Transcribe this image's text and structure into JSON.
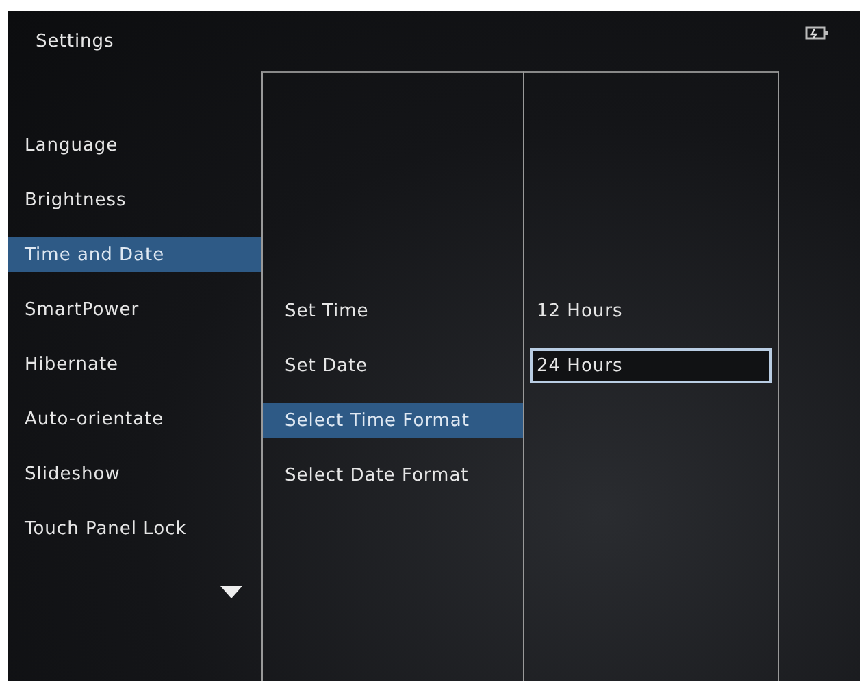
{
  "window": {
    "title": "Settings"
  },
  "menu": [
    {
      "label": "Language",
      "selected": false
    },
    {
      "label": "Brightness",
      "selected": false
    },
    {
      "label": "Time and Date",
      "selected": true
    },
    {
      "label": "SmartPower",
      "selected": false
    },
    {
      "label": "Hibernate",
      "selected": false
    },
    {
      "label": "Auto-orientate",
      "selected": false
    },
    {
      "label": "Slideshow",
      "selected": false
    },
    {
      "label": "Touch Panel Lock",
      "selected": false
    }
  ],
  "submenu": [
    {
      "label": "Set Time",
      "selected": false
    },
    {
      "label": "Set Date",
      "selected": false
    },
    {
      "label": "Select Time Format",
      "selected": true
    },
    {
      "label": "Select Date Format",
      "selected": false
    }
  ],
  "options": [
    {
      "label": "12 Hours",
      "selected": false
    },
    {
      "label": "24 Hours",
      "selected": true
    }
  ]
}
